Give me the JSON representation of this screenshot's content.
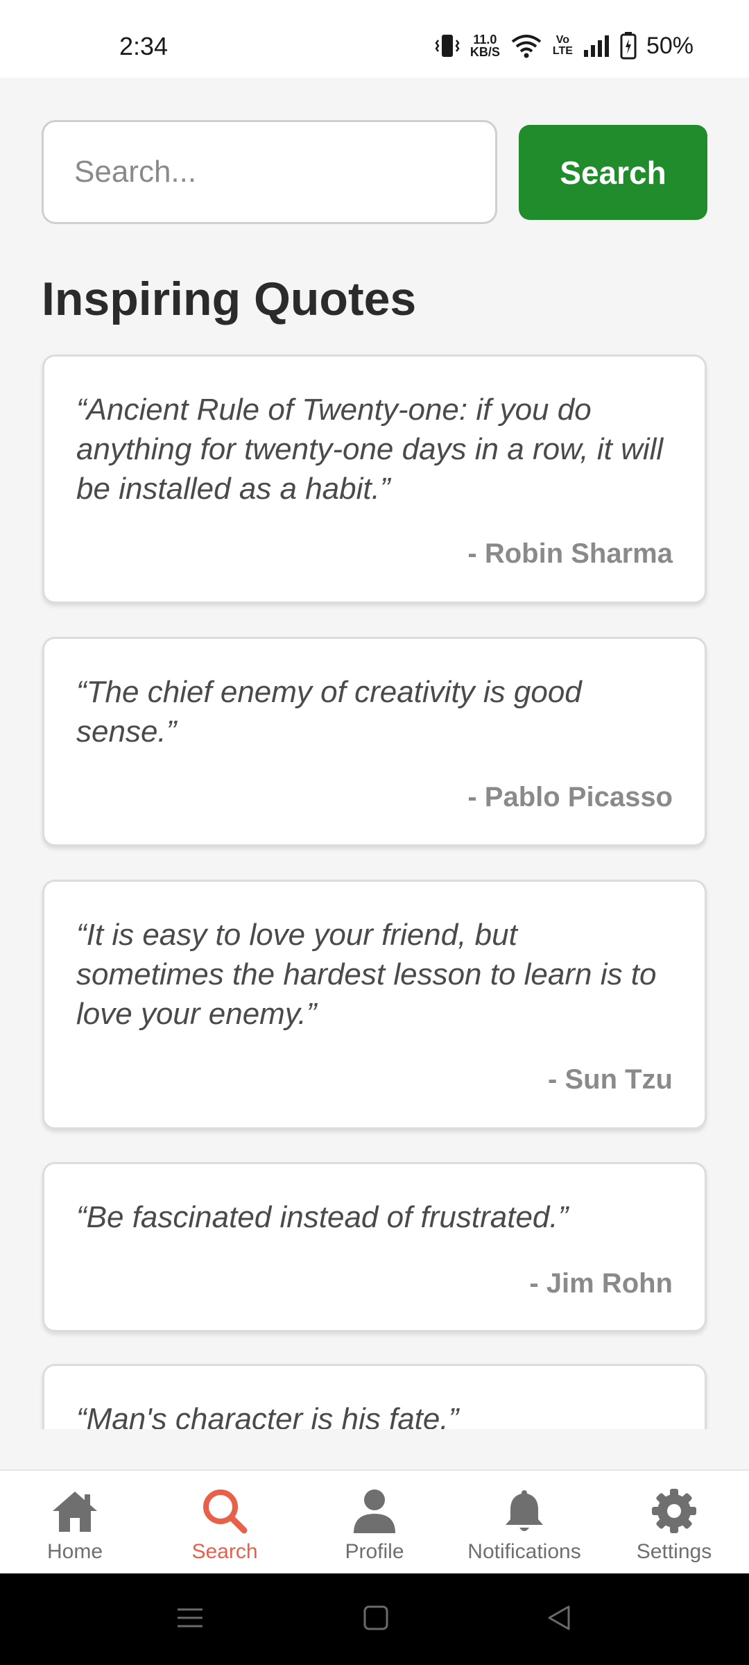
{
  "status_bar": {
    "time": "2:34",
    "net_speed_value": "11.0",
    "net_speed_unit": "KB/S",
    "volte_top": "Vo",
    "volte_bottom": "LTE",
    "battery": "50%"
  },
  "search": {
    "placeholder": "Search...",
    "value": "",
    "button_label": "Search"
  },
  "page_title": "Inspiring Quotes",
  "quotes": [
    {
      "text": "“Ancient Rule of Twenty-one: if you do anything for twenty-one days in a row, it will be installed as a habit.”",
      "author": "- Robin Sharma"
    },
    {
      "text": "“The chief enemy of creativity is good sense.”",
      "author": "- Pablo Picasso"
    },
    {
      "text": "“It is easy to love your friend, but sometimes the hardest lesson to learn is to love your enemy.”",
      "author": "- Sun Tzu"
    },
    {
      "text": "“Be fascinated instead of frustrated.”",
      "author": "- Jim Rohn"
    },
    {
      "text": "“Man's character is his fate.”",
      "author": ""
    }
  ],
  "bottom_nav": {
    "items": [
      {
        "label": "Home",
        "icon": "home-icon"
      },
      {
        "label": "Search",
        "icon": "search-icon",
        "active": true
      },
      {
        "label": "Profile",
        "icon": "person-icon"
      },
      {
        "label": "Notifications",
        "icon": "bell-icon"
      },
      {
        "label": "Settings",
        "icon": "gear-icon"
      }
    ]
  },
  "colors": {
    "accent_green": "#218c2c",
    "active_nav": "#e8604a",
    "inactive_nav": "#6f6f6f"
  }
}
